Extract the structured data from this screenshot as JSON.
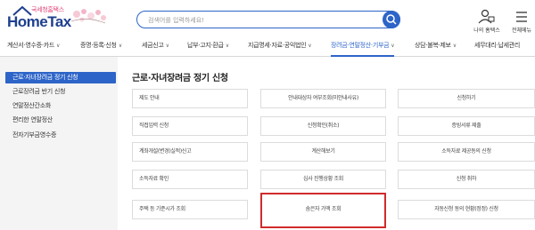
{
  "header": {
    "logo_sub": "국세청홈택스",
    "logo_main": "HomeTax",
    "search_placeholder": "검색어를 입력하세요!",
    "login_label": "나의 홈택스",
    "menu_label": "전체메뉴"
  },
  "nav": {
    "items": [
      "계산서·영수증·카드",
      "증명·등록·신청",
      "세금신고",
      "납부·고지·환급",
      "지급명세·자료·공익법인",
      "장려금·연말정산·기부금",
      "상담·불복·제보",
      "세무대리·납세관리"
    ],
    "active_index": 5
  },
  "sidebar": {
    "items": [
      "근로·자녀장려금 정기 신청",
      "근로장려금 반기 신청",
      "연말정산간소화",
      "편리한 연말정산",
      "전자기부금영수증"
    ],
    "active_index": 0
  },
  "main": {
    "title": "근로·자녀장려금 정기 신청",
    "cards": [
      "제도 안내",
      "안내대상자 여부조회(미안내사유)",
      "신청하기",
      "직접입력 신청",
      "신청확인(취소)",
      "증빙서류 제출",
      "계좌개설(변경)실적)신고",
      "계산해보기",
      "소득자료 제공동의 신청",
      "소득자료 확인",
      "심사 진행상황 조회",
      "신청 취하",
      "주택 등 기준시가 조회",
      "숨은자 가액 조회",
      "자동신청 동의 현황(정정) 신청"
    ],
    "highlighted_card": "숨은자 가액 조회"
  },
  "colors": {
    "brand_blue": "#2d64c8",
    "highlight_red": "#d12b2b",
    "logo_pink": "#e0457b"
  }
}
